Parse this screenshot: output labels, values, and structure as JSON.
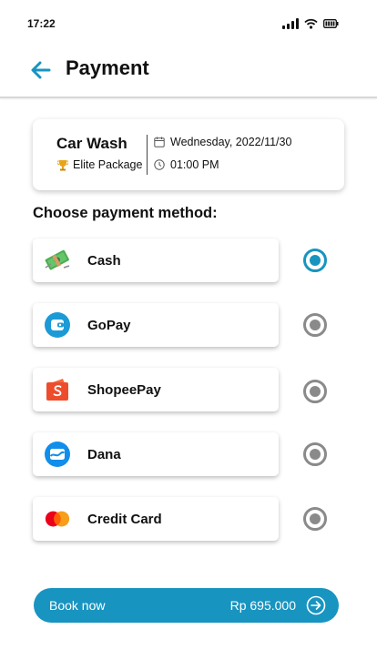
{
  "status_bar": {
    "time": "17:22"
  },
  "header": {
    "title": "Payment"
  },
  "booking": {
    "service": "Car Wash",
    "package": "Elite Package",
    "date": "Wednesday, 2022/11/30",
    "time": "01:00 PM"
  },
  "section_title": "Choose payment method:",
  "methods": [
    {
      "label": "Cash",
      "icon": "cash-icon",
      "selected": true
    },
    {
      "label": "GoPay",
      "icon": "gopay-icon",
      "selected": false
    },
    {
      "label": "ShopeePay",
      "icon": "shopeepay-icon",
      "selected": false
    },
    {
      "label": "Dana",
      "icon": "dana-icon",
      "selected": false
    },
    {
      "label": "Credit Card",
      "icon": "credit-card-icon",
      "selected": false
    }
  ],
  "book": {
    "label": "Book now",
    "price": "Rp 695.000"
  },
  "colors": {
    "accent": "#1894c0",
    "radio_off": "#8a8a8a"
  }
}
